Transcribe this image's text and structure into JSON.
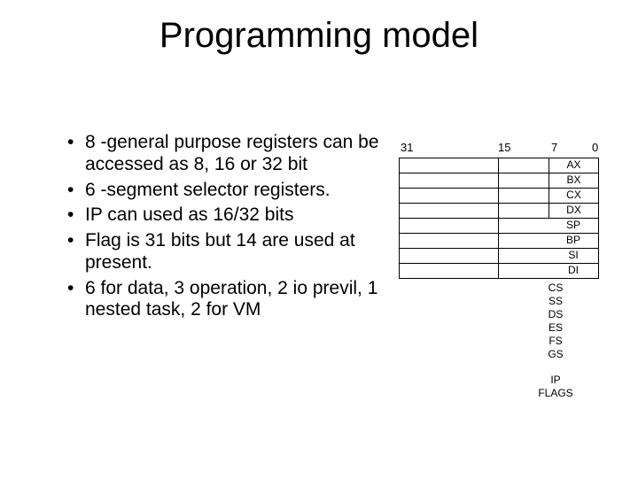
{
  "title": "Programming model",
  "bullets": [
    "8 -general purpose registers can be accessed as 8, 16 or 32 bit",
    "6 -segment selector registers.",
    "IP can used as 16/32 bits",
    "Flag is 31 bits but 14 are used at present.",
    "6 for data, 3 operation, 2 io previl, 1 nested task, 2 for VM"
  ],
  "bits": {
    "b31": "31",
    "b15": "15",
    "b7": "7",
    "b0": "0"
  },
  "gp_regs": {
    "sub4": [
      "AX",
      "BX",
      "CX",
      "DX"
    ],
    "plain": [
      "SP",
      "BP",
      "SI",
      "DI"
    ]
  },
  "seg_regs": [
    "CS",
    "SS",
    "DS",
    "ES",
    "FS",
    "GS"
  ],
  "ip_flags": [
    "IP",
    "FLAGS"
  ]
}
